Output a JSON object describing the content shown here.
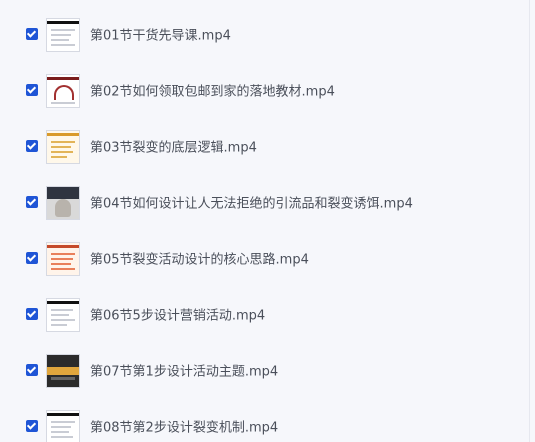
{
  "files": [
    {
      "name": "第01节干货先导课.mp4",
      "checked": true
    },
    {
      "name": "第02节如何领取包邮到家的落地教材.mp4",
      "checked": true
    },
    {
      "name": "第03节裂变的底层逻辑.mp4",
      "checked": true
    },
    {
      "name": "第04节如何设计让人无法拒绝的引流品和裂变诱饵.mp4",
      "checked": true
    },
    {
      "name": "第05节裂变活动设计的核心思路.mp4",
      "checked": true
    },
    {
      "name": "第06节5步设计营销活动.mp4",
      "checked": true
    },
    {
      "name": "第07节第1步设计活动主题.mp4",
      "checked": true
    },
    {
      "name": "第08节第2步设计裂变机制.mp4",
      "checked": true
    }
  ]
}
